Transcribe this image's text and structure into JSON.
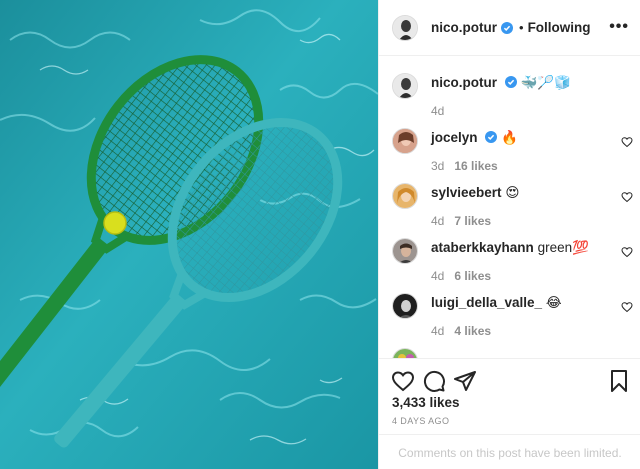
{
  "colors": {
    "text": "#262626",
    "muted": "#8e8e8e",
    "verified": "#3897f0",
    "divider": "#efefef",
    "water": "#25a6b3",
    "racket_green": "#1f8e3a",
    "racket_teal": "#3eb6bd",
    "ball": "#d9df1e"
  },
  "post": {
    "image_alt": "Tennis rackets floating in pool water",
    "header": {
      "username": "nico.potur",
      "verified_icon": "verified-badge",
      "separator": "•",
      "follow_label": "Following",
      "more_label": "•••"
    },
    "caption": {
      "username": "nico.potur",
      "text": "🐳🏸🧊",
      "time": "4d"
    },
    "comments": [
      {
        "username": "jocelyn",
        "verified": true,
        "text": "🔥",
        "time": "3d",
        "likes": "16 likes",
        "avatar_color": "#c98f7a"
      },
      {
        "username": "sylvieebert",
        "verified": false,
        "text": "😍",
        "time": "4d",
        "likes": "7 likes",
        "avatar_color": "#d9a05a"
      },
      {
        "username": "ataberkkayhann",
        "verified": false,
        "text": "green💯",
        "time": "4d",
        "likes": "6 likes",
        "avatar_color": "#8a7e78"
      },
      {
        "username": "luigi_della_valle_",
        "verified": false,
        "text": "😂",
        "time": "4d",
        "likes": "4 likes",
        "avatar_color": "#2b2b2b"
      }
    ],
    "likes": "3,433 likes",
    "posted": "4 DAYS AGO",
    "comments_limited": "Comments on this post have been limited."
  }
}
